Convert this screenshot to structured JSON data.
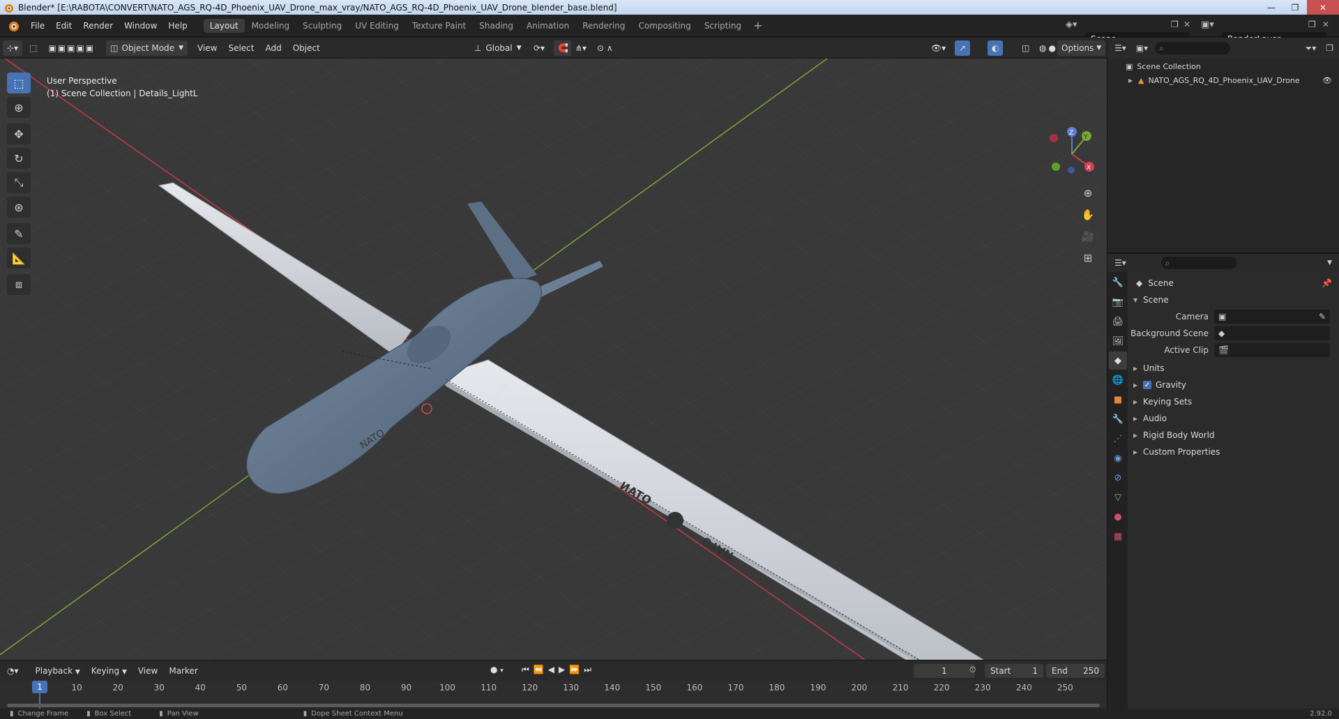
{
  "window": {
    "title": "Blender* [E:\\RABOTA\\CONVERT\\NATO_AGS_RQ-4D_Phoenix_UAV_Drone_max_vray/NATO_AGS_RQ-4D_Phoenix_UAV_Drone_blender_base.blend]",
    "min": "—",
    "max": "❐",
    "close": "✕"
  },
  "menus": [
    "File",
    "Edit",
    "Render",
    "Window",
    "Help"
  ],
  "workspaces": [
    "Layout",
    "Modeling",
    "Sculpting",
    "UV Editing",
    "Texture Paint",
    "Shading",
    "Animation",
    "Rendering",
    "Compositing",
    "Scripting"
  ],
  "workspace_add": "+",
  "scene_name": "Scene",
  "render_layer": "RenderLayer",
  "viewport": {
    "mode": "Object Mode",
    "menus": [
      "View",
      "Select",
      "Add",
      "Object"
    ],
    "orientation": "Global",
    "options": "Options",
    "overlay_line1": "User Perspective",
    "overlay_line2": "(1) Scene Collection | Details_LightL",
    "gizmo": {
      "z": "Z",
      "y": "Y",
      "x": "X"
    },
    "decal_nato": "NATO",
    "decal_otan": "OTAN"
  },
  "outliner": {
    "root": "Scene Collection",
    "items": [
      "NATO_AGS_RQ_4D_Phoenix_UAV_Drone"
    ]
  },
  "properties": {
    "context": "Scene",
    "section": "Scene",
    "camera_label": "Camera",
    "background_label": "Background Scene",
    "clip_label": "Active Clip",
    "panels": [
      "Units",
      "Gravity",
      "Keying Sets",
      "Audio",
      "Rigid Body World",
      "Custom Properties"
    ],
    "gravity_checked": true
  },
  "timeline": {
    "menus": [
      "Playback",
      "Keying",
      "View",
      "Marker"
    ],
    "current_frame": "1",
    "start_label": "Start",
    "start": "1",
    "end_label": "End",
    "end": "250",
    "ticks": [
      "10",
      "20",
      "30",
      "40",
      "50",
      "60",
      "70",
      "80",
      "90",
      "100",
      "110",
      "120",
      "130",
      "140",
      "150",
      "160",
      "170",
      "180",
      "190",
      "200",
      "210",
      "220",
      "230",
      "240",
      "250"
    ]
  },
  "status": {
    "items": [
      "Change Frame",
      "Box Select",
      "Pan View",
      "Dope Sheet Context Menu"
    ],
    "version": "2.92.0"
  },
  "colors": {
    "accent": "#4772b3",
    "x_axis": "#c43a44",
    "y_axis": "#7aa832",
    "viewport_bg": "#393939"
  }
}
